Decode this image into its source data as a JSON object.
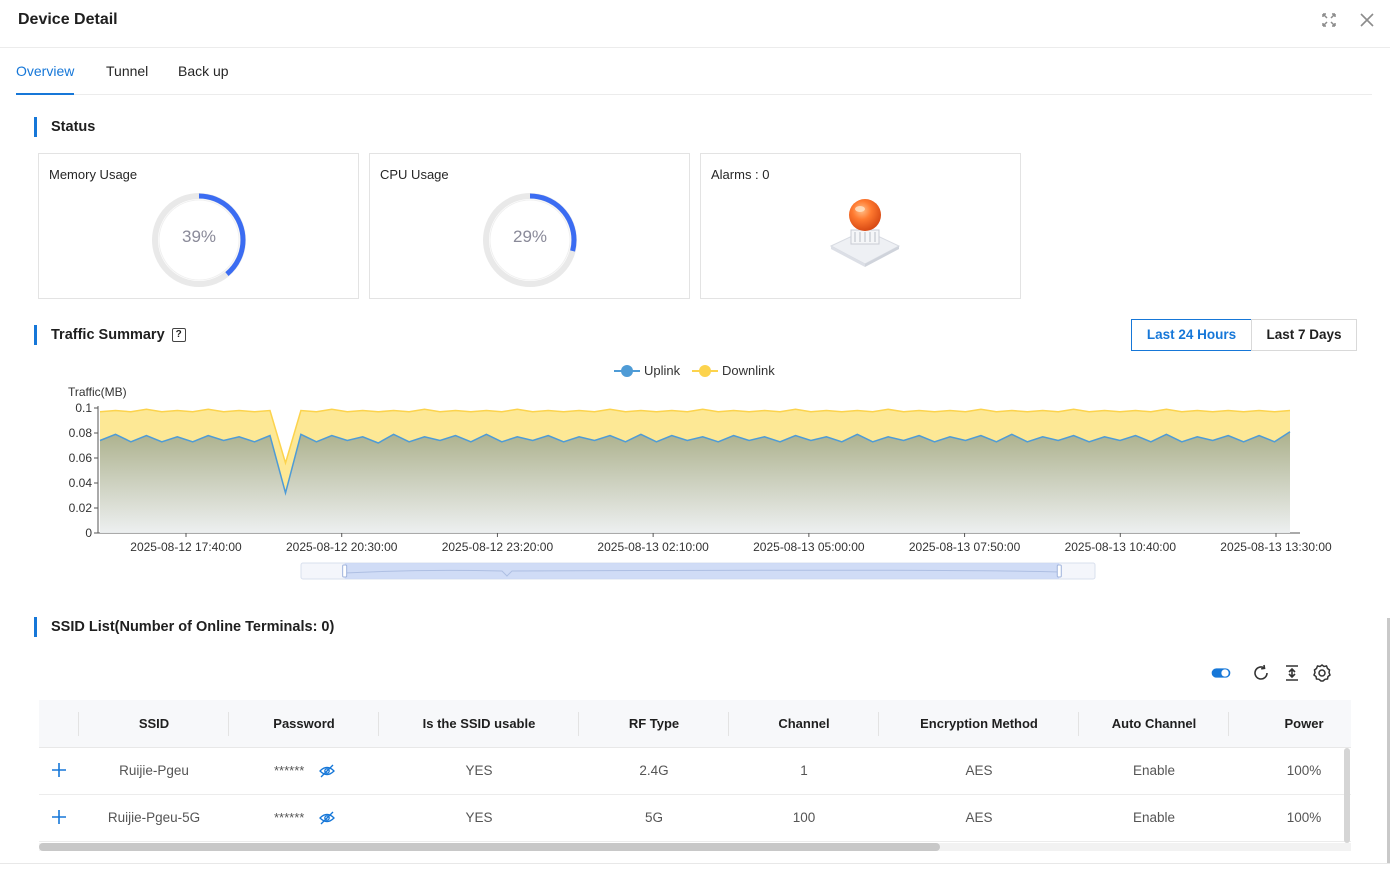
{
  "header": {
    "title": "Device Detail"
  },
  "tabs": [
    {
      "label": "Overview",
      "active": true
    },
    {
      "label": "Tunnel",
      "active": false
    },
    {
      "label": "Back up",
      "active": false
    }
  ],
  "status": {
    "title": "Status",
    "memory": {
      "label": "Memory Usage",
      "value": 39,
      "text": "39%"
    },
    "cpu": {
      "label": "CPU Usage",
      "value": 29,
      "text": "29%"
    },
    "alarms": {
      "label": "Alarms : 0",
      "icon": "alarm-light-icon"
    }
  },
  "traffic": {
    "title": "Traffic Summary",
    "help_icon": "question-icon",
    "range_buttons": [
      {
        "label": "Last 24 Hours",
        "active": true
      },
      {
        "label": "Last 7 Days",
        "active": false
      }
    ]
  },
  "chart_data": {
    "type": "area",
    "ylabel": "Traffic(MB)",
    "ylim": [
      0,
      0.1
    ],
    "yticks": [
      "0",
      "0.02",
      "0.04",
      "0.06",
      "0.08",
      "0.1"
    ],
    "xticks": [
      "2025-08-12 17:40:00",
      "2025-08-12 20:30:00",
      "2025-08-12 23:20:00",
      "2025-08-13 02:10:00",
      "2025-08-13 05:00:00",
      "2025-08-13 07:50:00",
      "2025-08-13 10:40:00",
      "2025-08-13 13:30:00"
    ],
    "legend": {
      "position": "top-center"
    },
    "colors": {
      "uplink": "#4e9bd6",
      "downlink": "#fcd34d"
    },
    "series": [
      {
        "name": "Uplink",
        "values": [
          0.074,
          0.079,
          0.073,
          0.078,
          0.073,
          0.077,
          0.073,
          0.078,
          0.074,
          0.077,
          0.073,
          0.078,
          0.032,
          0.079,
          0.073,
          0.078,
          0.074,
          0.077,
          0.072,
          0.079,
          0.073,
          0.077,
          0.074,
          0.078,
          0.073,
          0.079,
          0.073,
          0.077,
          0.074,
          0.078,
          0.073,
          0.077,
          0.074,
          0.078,
          0.073,
          0.079,
          0.073,
          0.078,
          0.074,
          0.077,
          0.073,
          0.078,
          0.074,
          0.077,
          0.073,
          0.078,
          0.074,
          0.077,
          0.073,
          0.079,
          0.073,
          0.077,
          0.074,
          0.078,
          0.073,
          0.077,
          0.074,
          0.078,
          0.073,
          0.079,
          0.073,
          0.077,
          0.074,
          0.078,
          0.073,
          0.077,
          0.074,
          0.078,
          0.073,
          0.079,
          0.073,
          0.077,
          0.074,
          0.078,
          0.073,
          0.078,
          0.073,
          0.081
        ]
      },
      {
        "name": "Downlink",
        "values": [
          0.097,
          0.098,
          0.097,
          0.099,
          0.097,
          0.098,
          0.097,
          0.099,
          0.097,
          0.098,
          0.097,
          0.098,
          0.056,
          0.098,
          0.097,
          0.099,
          0.097,
          0.098,
          0.097,
          0.098,
          0.097,
          0.099,
          0.097,
          0.098,
          0.097,
          0.098,
          0.097,
          0.099,
          0.097,
          0.098,
          0.097,
          0.098,
          0.097,
          0.099,
          0.097,
          0.098,
          0.097,
          0.098,
          0.097,
          0.099,
          0.097,
          0.098,
          0.097,
          0.098,
          0.097,
          0.099,
          0.097,
          0.098,
          0.097,
          0.098,
          0.097,
          0.099,
          0.097,
          0.098,
          0.097,
          0.098,
          0.097,
          0.099,
          0.097,
          0.098,
          0.097,
          0.098,
          0.097,
          0.099,
          0.097,
          0.098,
          0.097,
          0.098,
          0.097,
          0.099,
          0.097,
          0.098,
          0.097,
          0.098,
          0.097,
          0.098,
          0.097,
          0.098
        ]
      }
    ],
    "zoom_window": [
      0.055,
      0.955
    ]
  },
  "ssid": {
    "title": "SSID List(Number of Online Terminals:  0)",
    "toolbar": {
      "toggle_on": true,
      "icons": [
        "toggle-icon",
        "refresh-icon",
        "export-icon",
        "settings-icon"
      ]
    },
    "columns": [
      "SSID",
      "Password",
      "Is the SSID usable",
      "RF Type",
      "Channel",
      "Encryption Method",
      "Auto Channel",
      "Power"
    ],
    "rows": [
      {
        "ssid": "Ruijie-Pgeu",
        "password": "******",
        "usable": "YES",
        "rf": "2.4G",
        "channel": "1",
        "encryption": "AES",
        "auto_channel": "Enable",
        "power": "100%"
      },
      {
        "ssid": "Ruijie-Pgeu-5G",
        "password": "******",
        "usable": "YES",
        "rf": "5G",
        "channel": "100",
        "encryption": "AES",
        "auto_channel": "Enable",
        "power": "100%"
      }
    ]
  }
}
